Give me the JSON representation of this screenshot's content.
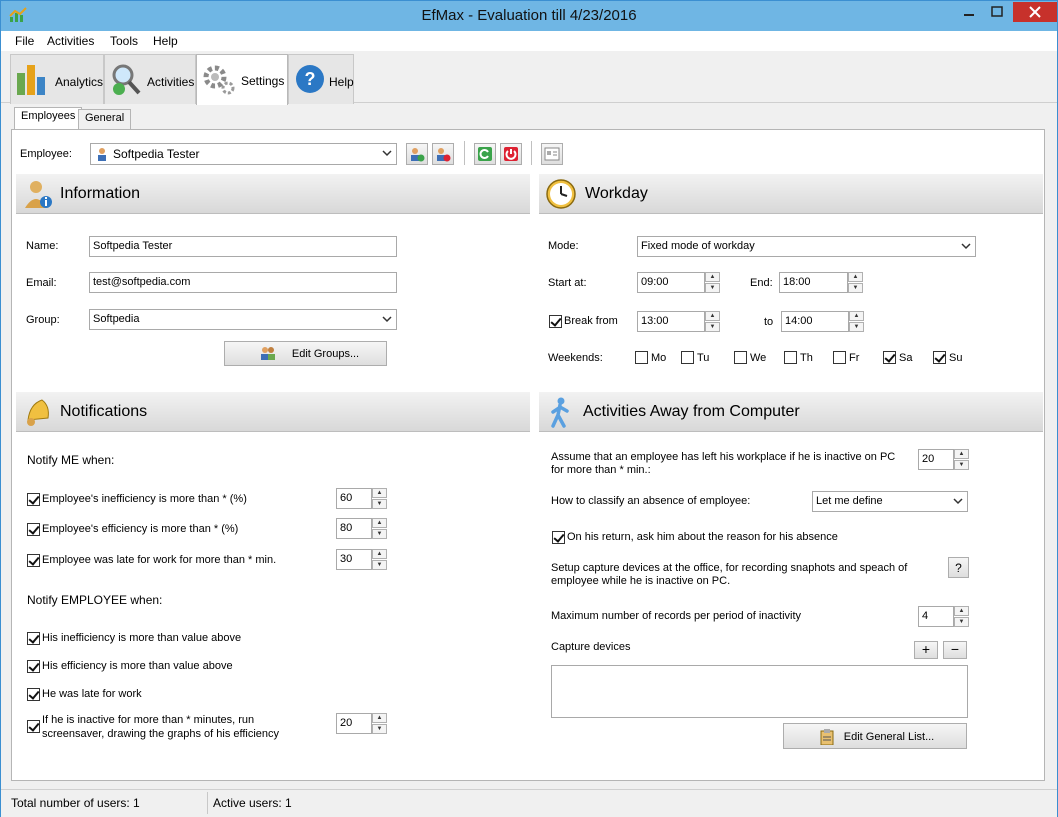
{
  "window": {
    "title": "EfMax - Evaluation till 4/23/2016"
  },
  "menu": [
    "File",
    "Activities",
    "Tools",
    "Help"
  ],
  "toolbar": {
    "analytics": "Analytics",
    "activities": "Activities",
    "settings": "Settings",
    "help": "Help"
  },
  "subtabs": {
    "employees": "Employees",
    "general": "General"
  },
  "employee": {
    "label": "Employee:",
    "value": "Softpedia Tester"
  },
  "information": {
    "title": "Information",
    "name_label": "Name:",
    "name_value": "Softpedia Tester",
    "email_label": "Email:",
    "email_value": "test@softpedia.com",
    "group_label": "Group:",
    "group_value": "Softpedia",
    "edit_groups": "Edit Groups..."
  },
  "workday": {
    "title": "Workday",
    "mode_label": "Mode:",
    "mode_value": "Fixed mode of workday",
    "start_label": "Start at:",
    "start_value": "09:00",
    "end_label": "End:",
    "end_value": "18:00",
    "break_label": "Break from",
    "break_checked": true,
    "break_from": "13:00",
    "to_label": "to",
    "break_to": "14:00",
    "weekends_label": "Weekends:",
    "days": [
      {
        "label": "Mo",
        "checked": false
      },
      {
        "label": "Tu",
        "checked": false
      },
      {
        "label": "We",
        "checked": false
      },
      {
        "label": "Th",
        "checked": false
      },
      {
        "label": "Fr",
        "checked": false
      },
      {
        "label": "Sa",
        "checked": true
      },
      {
        "label": "Su",
        "checked": true
      }
    ]
  },
  "notifications": {
    "title": "Notifications",
    "notify_me": "Notify ME when:",
    "me_items": [
      {
        "label": "Employee's inefficiency is more than * (%)",
        "value": "60",
        "checked": true
      },
      {
        "label": "Employee's efficiency is more than * (%)",
        "value": "80",
        "checked": true
      },
      {
        "label": "Employee was late for work for more than * min.",
        "value": "30",
        "checked": true
      }
    ],
    "notify_employee": "Notify EMPLOYEE when:",
    "emp_items": [
      {
        "label": "His inefficiency is more than value above",
        "checked": true
      },
      {
        "label": "His efficiency is more than value above",
        "checked": true
      },
      {
        "label": "He was late for work",
        "checked": true
      }
    ],
    "inactive_line1": "If he is inactive for more than * minutes, run",
    "inactive_line2": "screensaver, drawing the graphs of his efficiency",
    "inactive_value": "20",
    "inactive_checked": true
  },
  "away": {
    "title": "Activities Away from Computer",
    "assume_line1": "Assume that an employee has left his workplace if he is inactive on PC",
    "assume_line2": "for more than * min.:",
    "assume_value": "20",
    "classify_label": "How to classify an absence of employee:",
    "classify_value": "Let me define",
    "ask_reason": "On his return, ask him about the reason for his absence",
    "ask_checked": true,
    "setup_line1": "Setup capture devices at the office, for recording snaphots and speach of",
    "setup_line2": "employee while he is inactive on PC.",
    "help_q": "?",
    "max_records_label": "Maximum number of records per period of inactivity",
    "max_records_value": "4",
    "capture_label": "Capture devices",
    "plus": "+",
    "minus": "−",
    "edit_general": "Edit General List..."
  },
  "status": {
    "total": "Total number of users: 1",
    "active": "Active users: 1"
  }
}
